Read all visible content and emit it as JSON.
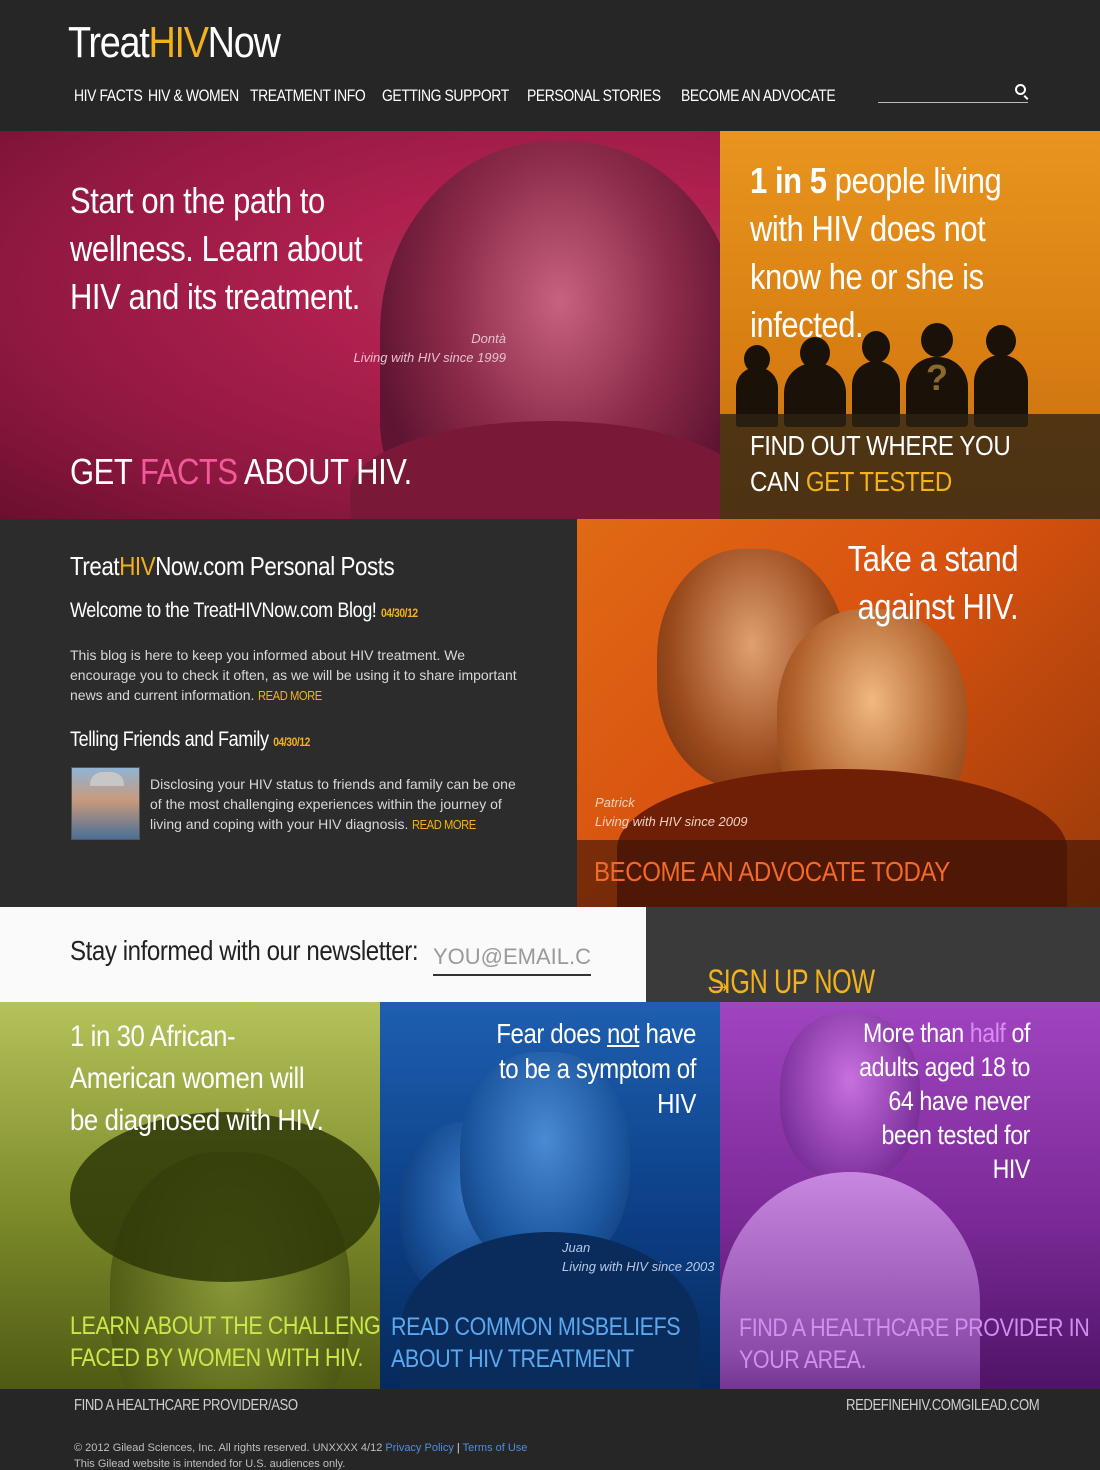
{
  "header": {
    "logo_pre": "Treat",
    "logo_hl": "HIV",
    "logo_post": "Now",
    "nav": [
      "HIV FACTS",
      "HIV & WOMEN",
      "TREATMENT INFO",
      "GETTING SUPPORT",
      "PERSONAL STORIES",
      "BECOME AN ADVOCATE"
    ],
    "search": {
      "placeholder": "",
      "icon": "search-icon"
    }
  },
  "hero": {
    "title": "Start on the path to wellness. Learn about HIV and its treatment.",
    "caption_name": "Dontà",
    "caption_since": "Living with HIV since 1999",
    "cta_pre": "GET ",
    "cta_hl": "FACTS",
    "cta_post": " ABOUT HIV."
  },
  "stat": {
    "bold": "1 in 5",
    "rest": " people living with HIV does not know he or she is infected.",
    "cta_line1": "FIND OUT WHERE YOU",
    "cta_pre": "CAN ",
    "cta_hl": "GET TESTED",
    "silhouette_mark": "?"
  },
  "blog": {
    "title_pre": "Treat",
    "title_hl": "HIV",
    "title_post": "Now.com Personal Posts",
    "posts": [
      {
        "title": "Welcome to the TreatHIVNow.com Blog!",
        "date": "04/30/12",
        "body": "This blog is here to keep you informed about HIV treatment. We encourage you to check it often, as we will be using it to share important news and current information.",
        "more": "READ MORE"
      },
      {
        "title": "Telling Friends and Family",
        "date": "04/30/12",
        "body": "Disclosing your HIV status to friends and family can be one of the most challenging experiences within the journey of living and coping with your HIV diagnosis.",
        "more": "READ MORE"
      }
    ]
  },
  "advocate": {
    "title_line1": "Take a stand",
    "title_line2": "against HIV.",
    "caption_name": "Patrick",
    "caption_since": "Living with HIV since 2009",
    "cta": "BECOME AN ADVOCATE TODAY"
  },
  "newsletter": {
    "label": "Stay informed with our newsletter:",
    "placeholder": "YOU@EMAIL.COM",
    "button": "SIGN UP NOW",
    "button_arrow": "→"
  },
  "panels": {
    "green": {
      "text": "1 in 30 African-American women will be diagnosed with HIV.",
      "cta_line1": "LEARN ABOUT THE CHALLENGES",
      "cta_line2": "FACED BY WOMEN WITH HIV."
    },
    "blue": {
      "text_pre": "Fear does ",
      "text_ul": "not",
      "text_post": " have to be a symptom of HIV",
      "caption_name": "Juan",
      "caption_since": "Living with HIV since 2003",
      "cta_line1": "READ COMMON MISBELIEFS",
      "cta_line2": "ABOUT HIV TREATMENT"
    },
    "purple": {
      "text_pre": "More than ",
      "text_hl": "half",
      "text_post": " of adults aged 18 to 64 have never been tested for HIV",
      "cta_line1": "FIND A HEALTHCARE PROVIDER IN",
      "cta_line2": "YOUR AREA."
    }
  },
  "footer": {
    "left_link": "FIND A HEALTHCARE PROVIDER/ASO",
    "right_links": [
      "REDEFINEHIV.COM",
      "GILEAD.COM"
    ],
    "copyright": "© 2012 Gilead Sciences, Inc. All rights reserved. UNXXXX 4/12",
    "privacy": "Privacy Policy",
    "terms": "Terms of Use",
    "audience": "This Gilead website is intended for U.S. audiences only."
  },
  "colors": {
    "accent_yellow": "#f3b21b",
    "hero_pink": "#b0204f",
    "stat_orange": "#e8951f",
    "advocate_orange": "#d8520f",
    "green": "#7c8a2a",
    "blue": "#0c3f86",
    "purple": "#7c2a98",
    "dark": "#262626"
  }
}
